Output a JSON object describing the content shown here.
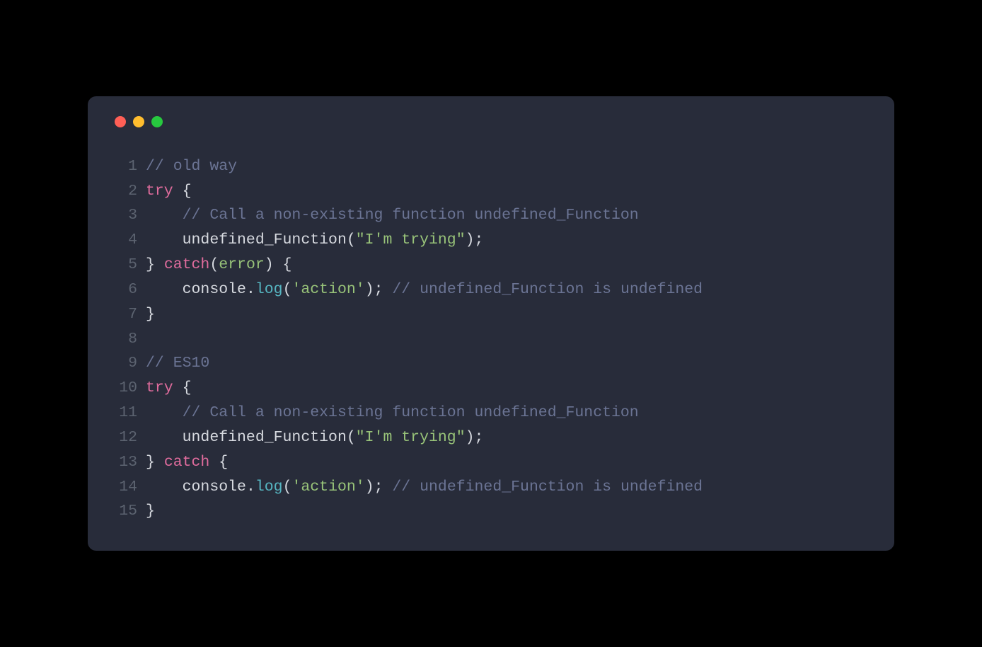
{
  "lines": [
    {
      "num": "1",
      "tokens": [
        {
          "cls": "comment",
          "text": "// old way"
        }
      ]
    },
    {
      "num": "2",
      "tokens": [
        {
          "cls": "keyword",
          "text": "try"
        },
        {
          "cls": "punct",
          "text": " {"
        }
      ]
    },
    {
      "num": "3",
      "tokens": [
        {
          "cls": "punct",
          "text": "    "
        },
        {
          "cls": "comment",
          "text": "// Call a non-existing function undefined_Function"
        }
      ]
    },
    {
      "num": "4",
      "tokens": [
        {
          "cls": "punct",
          "text": "    "
        },
        {
          "cls": "function-call",
          "text": "undefined_Function"
        },
        {
          "cls": "paren",
          "text": "("
        },
        {
          "cls": "string",
          "text": "\"I'm trying\""
        },
        {
          "cls": "paren",
          "text": ")"
        },
        {
          "cls": "punct",
          "text": ";"
        }
      ]
    },
    {
      "num": "5",
      "tokens": [
        {
          "cls": "punct",
          "text": "} "
        },
        {
          "cls": "keyword",
          "text": "catch"
        },
        {
          "cls": "paren",
          "text": "("
        },
        {
          "cls": "param",
          "text": "error"
        },
        {
          "cls": "paren",
          "text": ")"
        },
        {
          "cls": "punct",
          "text": " {"
        }
      ]
    },
    {
      "num": "6",
      "tokens": [
        {
          "cls": "punct",
          "text": "    "
        },
        {
          "cls": "object",
          "text": "console"
        },
        {
          "cls": "punct",
          "text": "."
        },
        {
          "cls": "method",
          "text": "log"
        },
        {
          "cls": "paren",
          "text": "("
        },
        {
          "cls": "string",
          "text": "'action'"
        },
        {
          "cls": "paren",
          "text": ")"
        },
        {
          "cls": "punct",
          "text": "; "
        },
        {
          "cls": "comment",
          "text": "// undefined_Function is undefined"
        }
      ]
    },
    {
      "num": "7",
      "tokens": [
        {
          "cls": "punct",
          "text": "}"
        }
      ]
    },
    {
      "num": "8",
      "tokens": [
        {
          "cls": "punct",
          "text": ""
        }
      ]
    },
    {
      "num": "9",
      "tokens": [
        {
          "cls": "comment",
          "text": "// ES10"
        }
      ]
    },
    {
      "num": "10",
      "tokens": [
        {
          "cls": "keyword",
          "text": "try"
        },
        {
          "cls": "punct",
          "text": " {"
        }
      ]
    },
    {
      "num": "11",
      "tokens": [
        {
          "cls": "punct",
          "text": "    "
        },
        {
          "cls": "comment",
          "text": "// Call a non-existing function undefined_Function"
        }
      ]
    },
    {
      "num": "12",
      "tokens": [
        {
          "cls": "punct",
          "text": "    "
        },
        {
          "cls": "function-call",
          "text": "undefined_Function"
        },
        {
          "cls": "paren",
          "text": "("
        },
        {
          "cls": "string",
          "text": "\"I'm trying\""
        },
        {
          "cls": "paren",
          "text": ")"
        },
        {
          "cls": "punct",
          "text": ";"
        }
      ]
    },
    {
      "num": "13",
      "tokens": [
        {
          "cls": "punct",
          "text": "} "
        },
        {
          "cls": "keyword",
          "text": "catch"
        },
        {
          "cls": "punct",
          "text": " {"
        }
      ]
    },
    {
      "num": "14",
      "tokens": [
        {
          "cls": "punct",
          "text": "    "
        },
        {
          "cls": "object",
          "text": "console"
        },
        {
          "cls": "punct",
          "text": "."
        },
        {
          "cls": "method",
          "text": "log"
        },
        {
          "cls": "paren",
          "text": "("
        },
        {
          "cls": "string",
          "text": "'action'"
        },
        {
          "cls": "paren",
          "text": ")"
        },
        {
          "cls": "punct",
          "text": "; "
        },
        {
          "cls": "comment",
          "text": "// undefined_Function is undefined"
        }
      ]
    },
    {
      "num": "15",
      "tokens": [
        {
          "cls": "punct",
          "text": "}"
        }
      ]
    }
  ]
}
